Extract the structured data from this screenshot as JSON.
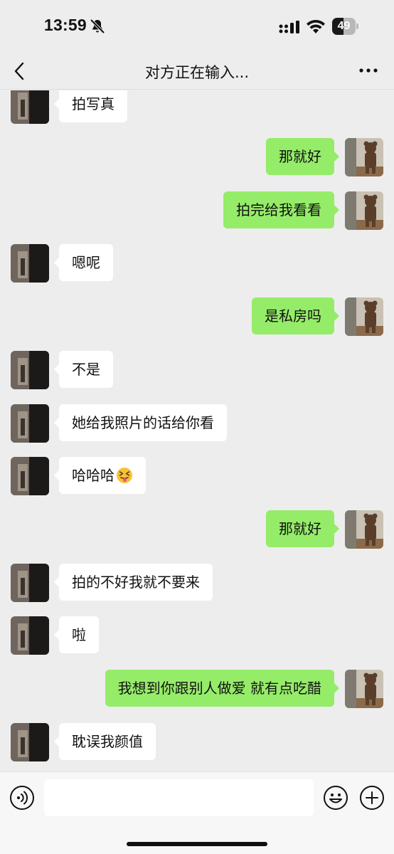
{
  "status_bar": {
    "time": "13:59",
    "battery_level": "49",
    "battery_fraction": 0.49
  },
  "nav": {
    "title": "对方正在输入..."
  },
  "messages": [
    {
      "side": "left",
      "text": "拍写真"
    },
    {
      "side": "right",
      "text": "那就好"
    },
    {
      "side": "right",
      "text": "拍完给我看看"
    },
    {
      "side": "left",
      "text": "嗯呢"
    },
    {
      "side": "right",
      "text": "是私房吗"
    },
    {
      "side": "left",
      "text": "不是"
    },
    {
      "side": "left",
      "text": "她给我照片的话给你看"
    },
    {
      "side": "left",
      "text": "哈哈哈",
      "emoji": "tongue-out-squint-emoji"
    },
    {
      "side": "right",
      "text": "那就好"
    },
    {
      "side": "left",
      "text": "拍的不好我就不要来"
    },
    {
      "side": "left",
      "text": "啦"
    },
    {
      "side": "right",
      "text": "我想到你跟别人做爱 就有点吃醋"
    },
    {
      "side": "left",
      "text": "耽误我颜值"
    }
  ],
  "input": {
    "value": "",
    "placeholder": ""
  },
  "icons": {
    "back": "back-chevron-icon",
    "more": "more-dots-icon",
    "voice": "voice-icon",
    "emoji": "emoji-icon",
    "plus": "plus-icon",
    "mute": "bell-slash-icon",
    "signal": "signal-icon",
    "wifi": "wifi-icon"
  },
  "colors": {
    "background": "#ededed",
    "bubble_self": "#95ec69",
    "bubble_other": "#ffffff"
  }
}
